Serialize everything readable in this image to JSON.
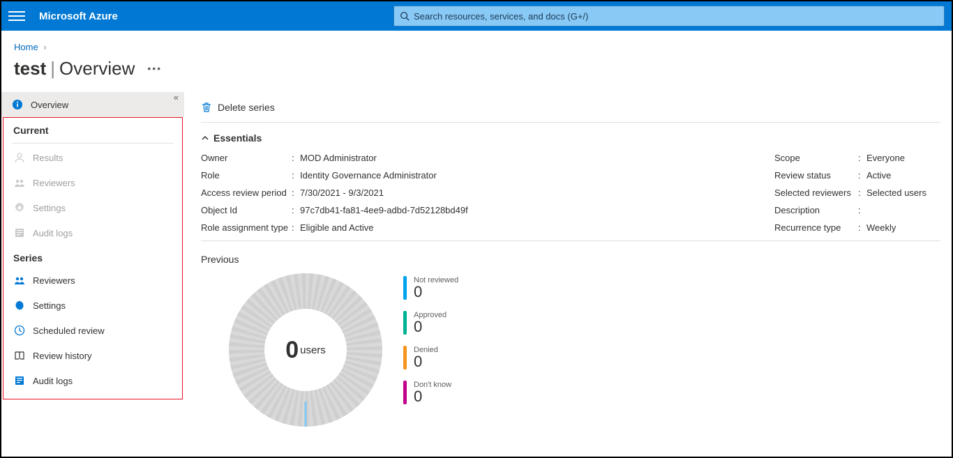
{
  "header": {
    "brand": "Microsoft Azure",
    "search_placeholder": "Search resources, services, and docs (G+/)"
  },
  "breadcrumb": {
    "home": "Home"
  },
  "page": {
    "title_main": "test",
    "title_sub": "Overview",
    "more": "…"
  },
  "sidebar": {
    "overview": "Overview",
    "current_title": "Current",
    "current_items": {
      "results": "Results",
      "reviewers": "Reviewers",
      "settings": "Settings",
      "audit_logs": "Audit logs"
    },
    "series_title": "Series",
    "series_items": {
      "reviewers": "Reviewers",
      "settings": "Settings",
      "scheduled_review": "Scheduled review",
      "review_history": "Review history",
      "audit_logs": "Audit logs"
    }
  },
  "toolbar": {
    "delete_series": "Delete series"
  },
  "essentials": {
    "heading": "Essentials",
    "left": {
      "owner_k": "Owner",
      "owner_v": "MOD Administrator",
      "role_k": "Role",
      "role_v": "Identity Governance Administrator",
      "period_k": "Access review period",
      "period_v": "7/30/2021 - 9/3/2021",
      "objectid_k": "Object Id",
      "objectid_v": "97c7db41-fa81-4ee9-adbd-7d52128bd49f",
      "rat_k": "Role assignment type",
      "rat_v": "Eligible and Active"
    },
    "right": {
      "scope_k": "Scope",
      "scope_v": "Everyone",
      "status_k": "Review status",
      "status_v": "Active",
      "reviewers_k": "Selected reviewers",
      "reviewers_v": "Selected users",
      "desc_k": "Description",
      "desc_v": "",
      "recur_k": "Recurrence type",
      "recur_v": "Weekly"
    }
  },
  "previous": {
    "title": "Previous",
    "donut_value": "0",
    "donut_label": "users",
    "legend": {
      "not_reviewed": {
        "label": "Not reviewed",
        "value": "0",
        "color": "#00a2ed"
      },
      "approved": {
        "label": "Approved",
        "value": "0",
        "color": "#00b294"
      },
      "denied": {
        "label": "Denied",
        "value": "0",
        "color": "#f7941d"
      },
      "dont_know": {
        "label": "Don't know",
        "value": "0",
        "color": "#c3008c"
      }
    }
  },
  "chart_data": {
    "type": "pie",
    "title": "Previous",
    "categories": [
      "Not reviewed",
      "Approved",
      "Denied",
      "Don't know"
    ],
    "values": [
      0,
      0,
      0,
      0
    ],
    "total_label": "users",
    "total_value": 0
  }
}
